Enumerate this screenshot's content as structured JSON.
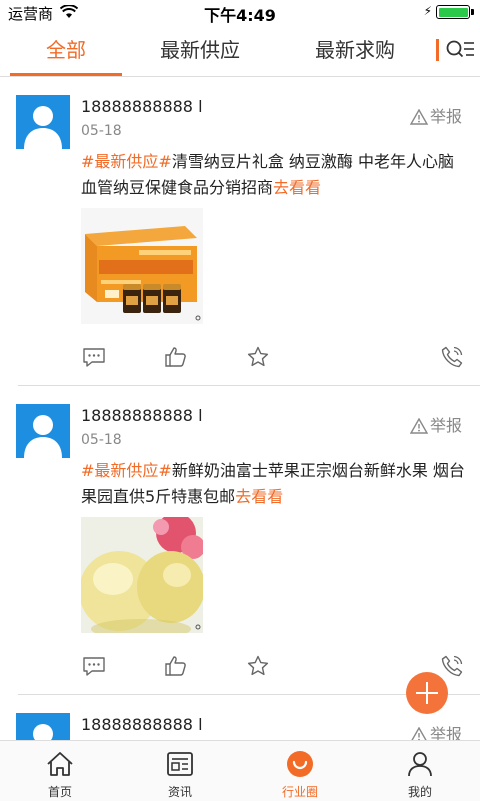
{
  "status_bar": {
    "carrier": "运营商",
    "time": "下午4:49",
    "battery_level": 1.0
  },
  "tabs": [
    {
      "label": "全部",
      "active": true
    },
    {
      "label": "最新供应",
      "active": false
    },
    {
      "label": "最新求购",
      "active": false
    }
  ],
  "posts": [
    {
      "author": "18888888888 l",
      "date": "05-18",
      "report_label": "举报",
      "tag": "#最新供应#",
      "text": "清雪纳豆片礼盒 纳豆激酶 中老年人心脑血管纳豆保健食品分销招商",
      "more_label": "去看看",
      "image_alt": "纳豆片礼盒产品图"
    },
    {
      "author": "18888888888 l",
      "date": "05-18",
      "report_label": "举报",
      "tag": "#最新供应#",
      "text": "新鲜奶油富士苹果正宗烟台新鲜水果 烟台果园直供5斤特惠包邮",
      "more_label": "去看看",
      "image_alt": "苹果产品图"
    },
    {
      "author": "18888888888 l",
      "date": "",
      "report_label": "举报",
      "tag": "",
      "text": "",
      "more_label": "",
      "image_alt": ""
    }
  ],
  "bottom_nav": [
    {
      "label": "首页",
      "icon": "home-icon",
      "active": false
    },
    {
      "label": "资讯",
      "icon": "news-icon",
      "active": false
    },
    {
      "label": "行业圈",
      "icon": "circle-icon",
      "active": true
    },
    {
      "label": "我的",
      "icon": "user-icon",
      "active": false
    }
  ],
  "colors": {
    "accent": "#f26b27",
    "avatar": "#1e8fe0",
    "text": "#222222",
    "muted": "#888888"
  }
}
